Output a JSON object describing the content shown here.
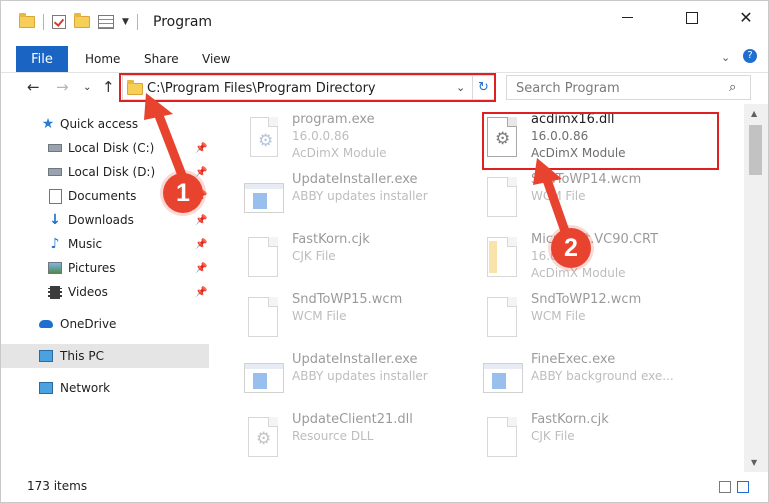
{
  "window": {
    "title": "Program",
    "controls": {
      "minimize": "—",
      "maximize": "☐",
      "close": "✕"
    }
  },
  "ribbon": {
    "tabs": [
      "File",
      "Home",
      "Share",
      "View"
    ]
  },
  "address": {
    "path": "C:\\Program Files\\Program Directory",
    "search_placeholder": "Search Program"
  },
  "sidebar": {
    "items": [
      {
        "label": "Quick access",
        "icon": "star-icon",
        "pinned": false
      },
      {
        "label": "Local Disk (C:)",
        "icon": "drive-icon",
        "pinned": true
      },
      {
        "label": "Local Disk (D:)",
        "icon": "drive-icon",
        "pinned": true
      },
      {
        "label": "Documents",
        "icon": "documents-icon",
        "pinned": true
      },
      {
        "label": "Downloads",
        "icon": "download-icon",
        "pinned": true
      },
      {
        "label": "Music",
        "icon": "music-icon",
        "pinned": true
      },
      {
        "label": "Pictures",
        "icon": "pictures-icon",
        "pinned": true
      },
      {
        "label": "Videos",
        "icon": "videos-icon",
        "pinned": true
      },
      {
        "label": "OneDrive",
        "icon": "cloud-icon",
        "pinned": false
      },
      {
        "label": "This PC",
        "icon": "computer-icon",
        "pinned": false
      },
      {
        "label": "Network",
        "icon": "network-icon",
        "pinned": false
      }
    ]
  },
  "files": [
    {
      "name": "program.exe",
      "line1": "16.0.0.86",
      "line2": "AcDimX Module",
      "type": "exe",
      "dim": true
    },
    {
      "name": "acdimx16.dll",
      "line1": "16.0.0.86",
      "line2": "AcDimX Module",
      "type": "dll",
      "dim": false
    },
    {
      "name": "UpdateInstaller.exe",
      "line1": "ABBY updates installer",
      "line2": "",
      "type": "exe",
      "dim": true
    },
    {
      "name": "SndToWP14.wcm",
      "line1": "WCM File",
      "line2": "",
      "type": "doc",
      "dim": true
    },
    {
      "name": "FastKorn.cjk",
      "line1": "CJK File",
      "line2": "",
      "type": "doc",
      "dim": true
    },
    {
      "name": "Microsoft.VC90.CRT",
      "line1": "16.0.0.86",
      "line2": "AcDimX Module",
      "type": "folder",
      "dim": true
    },
    {
      "name": "SndToWP15.wcm",
      "line1": "WCM File",
      "line2": "",
      "type": "doc",
      "dim": true
    },
    {
      "name": "SndToWP12.wcm",
      "line1": "WCM File",
      "line2": "",
      "type": "doc",
      "dim": true
    },
    {
      "name": "UpdateInstaller.exe",
      "line1": "ABBY updates installer",
      "line2": "",
      "type": "exe",
      "dim": true
    },
    {
      "name": "FineExec.exe",
      "line1": "ABBY background exe...",
      "line2": "",
      "type": "exe",
      "dim": true
    },
    {
      "name": "UpdateClient21.dll",
      "line1": "Resource DLL",
      "line2": "",
      "type": "dll",
      "dim": true
    },
    {
      "name": "FastKorn.cjk",
      "line1": "CJK File",
      "line2": "",
      "type": "doc",
      "dim": true
    }
  ],
  "status": {
    "count": "173 items"
  },
  "annotations": {
    "step1": "1",
    "step2": "2"
  },
  "colors": {
    "accent": "#1a64c4",
    "annotation": "#e02020",
    "selection": "#e5e5e5"
  }
}
